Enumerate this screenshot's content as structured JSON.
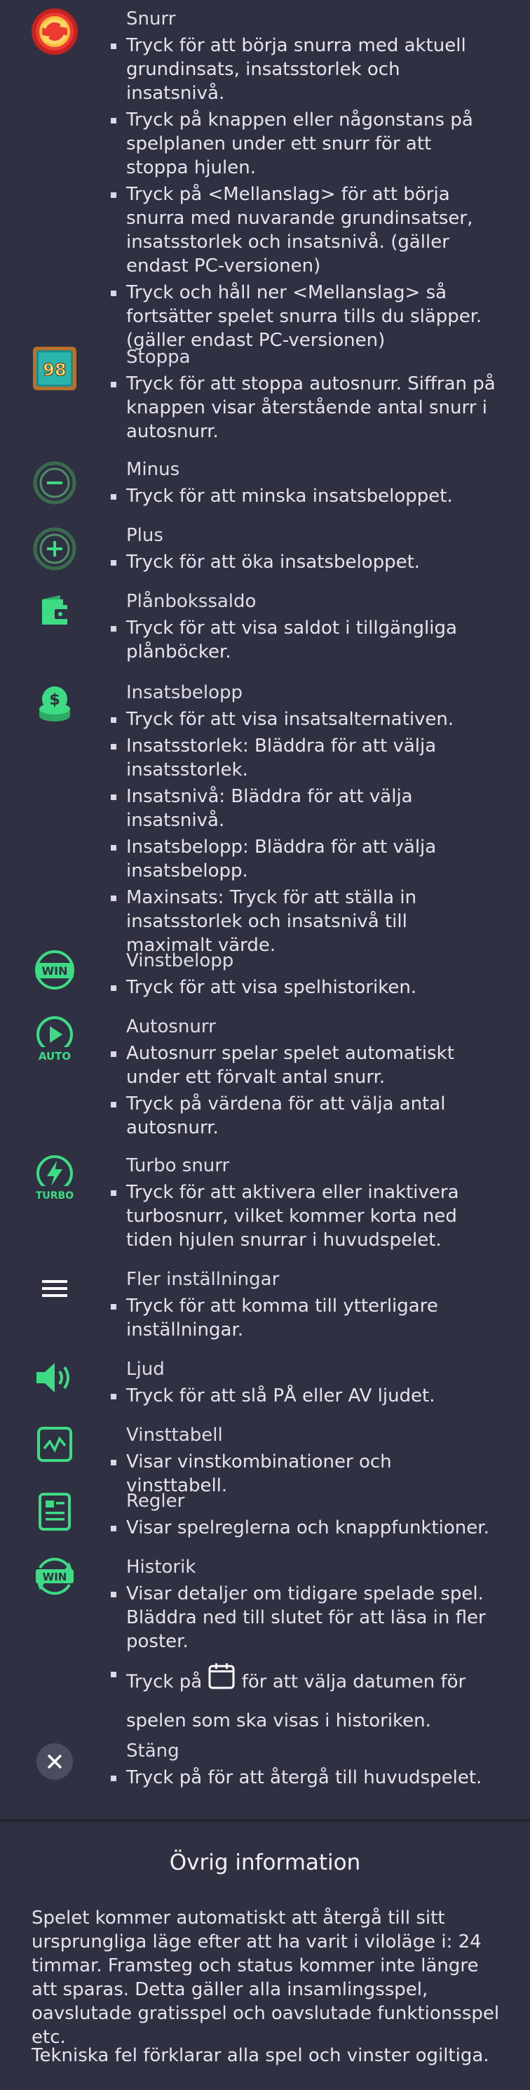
{
  "items": [
    {
      "title": "Snurr",
      "bullets": [
        "Tryck för att börja snurra med aktuell grundinsats, insatsstorlek och insatsnivå.",
        "Tryck på knappen eller någonstans på spelplanen under ett snurr för att stoppa hjulen.",
        "Tryck på <Mellanslag> för att börja snurra med nuvarande grundinsatser, insatsstorlek och insatsnivå. (gäller endast PC-versionen)",
        "Tryck och håll ner <Mellanslag> så fortsätter spelet snurra tills du släpper. (gäller endast PC-versionen)"
      ]
    },
    {
      "title": "Stoppa",
      "bullets": [
        "Tryck för att stoppa autosnurr. Siffran på knappen visar återstående antal snurr i autosnurr."
      ],
      "icon_text": "98"
    },
    {
      "title": "Minus",
      "bullets": [
        "Tryck för att minska insatsbeloppet."
      ]
    },
    {
      "title": "Plus",
      "bullets": [
        "Tryck för att öka insatsbeloppet."
      ]
    },
    {
      "title": "Plånbokssaldo",
      "bullets": [
        "Tryck för att visa saldot i tillgängliga plånböcker."
      ]
    },
    {
      "title": "Insatsbelopp",
      "bullets": [
        "Tryck för att visa insatsalternativen.",
        "Insatsstorlek: Bläddra för att välja insatsstorlek.",
        "Insatsnivå: Bläddra för att välja insatsnivå.",
        "Insatsbelopp: Bläddra för att välja insatsbelopp.",
        "Maxinsats: Tryck för att ställa in insatsstorlek och insatsnivå till maximalt värde."
      ]
    },
    {
      "title": "Vinstbelopp",
      "bullets": [
        "Tryck för att visa spelhistoriken."
      ],
      "icon_text": "WIN"
    },
    {
      "title": "Autosnurr",
      "bullets": [
        "Autosnurr spelar spelet automatiskt under ett förvalt antal snurr.",
        "Tryck på värdena för att välja antal autosnurr."
      ],
      "icon_text": "AUTO"
    },
    {
      "title": "Turbo snurr",
      "bullets": [
        "Tryck för att aktivera eller inaktivera turbosnurr, vilket kommer korta ned tiden hjulen snurrar i huvudspelet."
      ],
      "icon_text": "TURBO"
    },
    {
      "title": "Fler inställningar",
      "bullets": [
        "Tryck för att komma till ytterligare inställningar."
      ]
    },
    {
      "title": "Ljud",
      "bullets": [
        "Tryck för att slå PÅ eller AV ljudet."
      ]
    },
    {
      "title": "Vinsttabell",
      "bullets": [
        "Visar vinstkombinationer och vinsttabell."
      ]
    },
    {
      "title": "Regler",
      "bullets": [
        "Visar spelreglerna och knappfunktioner."
      ]
    },
    {
      "title": "Historik",
      "bullets": [
        "Visar detaljer om tidigare spelade spel. Bläddra ned till slutet för att läsa in fler poster."
      ],
      "calendar_before": "Tryck på",
      "calendar_after": "för att välja datumen för spelen som ska visas i historiken.",
      "icon_text": "WIN"
    },
    {
      "title": "Stäng",
      "bullets": [
        "Tryck på för att återgå till huvudspelet."
      ]
    }
  ],
  "info": {
    "title": "Övrig information",
    "p1": "Spelet kommer automatiskt att återgå till sitt ursprungliga läge efter att ha varit i viloläge i: 24 timmar. Framsteg och status kommer inte längre att sparas. Detta gäller alla insamlingsspel, oavslutade gratisspel och oavslutade funktionsspel etc.",
    "p2": "Tekniska fel förklarar alla spel och vinster ogiltiga."
  },
  "colors": {
    "accent": "#3ddc84",
    "background": "#2f3142",
    "spin_red": "#e8302e"
  }
}
